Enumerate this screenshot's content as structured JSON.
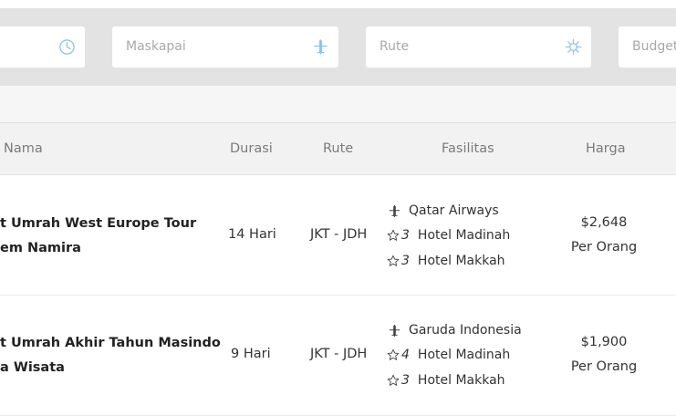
{
  "filters": {
    "maskapai_placeholder": "Maskapai",
    "rute_placeholder": "Rute",
    "budget_placeholder": "Budget",
    "icons": [
      "clock-icon",
      "plane-icon",
      "compass-icon"
    ]
  },
  "table": {
    "headers": {
      "nama": "Nama",
      "durasi": "Durasi",
      "rute": "Rute",
      "fasilitas": "Fasilitas",
      "harga": "Harga"
    },
    "rows": [
      {
        "name_line1": "t Umrah West Europe Tour",
        "name_line2": "em Namira",
        "durasi": "14 Hari",
        "rute": "JKT - JDH",
        "airline": "Qatar Airways",
        "hotel_madinah_stars": "3",
        "hotel_madinah_label": "Hotel Madinah",
        "hotel_makkah_stars": "3",
        "hotel_makkah_label": "Hotel Makkah",
        "price": "$2,648",
        "price_unit": "Per Orang"
      },
      {
        "name_line1": "t Umrah Akhir Tahun Masindo",
        "name_line2": "a Wisata",
        "durasi": "9 Hari",
        "rute": "JKT - JDH",
        "airline": "Garuda Indonesia",
        "hotel_madinah_stars": "4",
        "hotel_madinah_label": "Hotel Madinah",
        "hotel_makkah_stars": "3",
        "hotel_makkah_label": "Hotel Makkah",
        "price": "$1,900",
        "price_unit": "Per Orang"
      }
    ]
  },
  "colors": {
    "filter_bar_bg": "#e3e3e3",
    "icon_blue": "#8fc3ec",
    "header_bg": "#f2f2f2",
    "header_text": "#7b7b7b"
  }
}
